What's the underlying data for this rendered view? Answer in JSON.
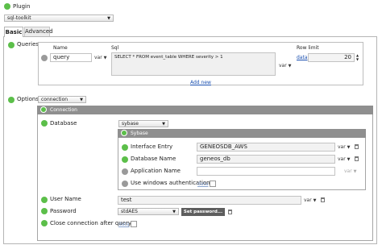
{
  "plugin": {
    "label": "Plugin",
    "value": "sql-toolkit"
  },
  "tabs": [
    {
      "label": "Basic"
    },
    {
      "label": "Advanced"
    }
  ],
  "queries": {
    "label": "Queries",
    "columns": {
      "name": "Name",
      "sql": "Sql",
      "row_limit": "Row limit"
    },
    "row": {
      "name": "query",
      "var": "var",
      "sql": "SELECT * FROM event_table WHERE severity > 1",
      "sql_var": "var",
      "row_limit_mode": "data",
      "row_limit_value": "20"
    },
    "add_new": "Add new"
  },
  "options": {
    "label": "Options",
    "value": "connection"
  },
  "connection": {
    "title": "Connection",
    "database": {
      "label": "Database",
      "value": "sybase"
    },
    "sybase": {
      "title": "Sybase",
      "interface_entry": {
        "label": "Interface Entry",
        "value": "GENEOSDB_AWS",
        "var": "var"
      },
      "database_name": {
        "label": "Database Name",
        "value": "geneos_db",
        "var": "var"
      },
      "application_name": {
        "label": "Application Name",
        "value": "",
        "var": "var"
      },
      "windows_auth": {
        "label": "Use windows authentication",
        "mode": "data"
      }
    },
    "user_name": {
      "label": "User Name",
      "value": "test",
      "var": "var"
    },
    "password": {
      "label": "Password",
      "value": "stdAES",
      "button": "Set password..."
    },
    "close_after_query": {
      "label": "Close connection after query",
      "mode": "data"
    }
  }
}
